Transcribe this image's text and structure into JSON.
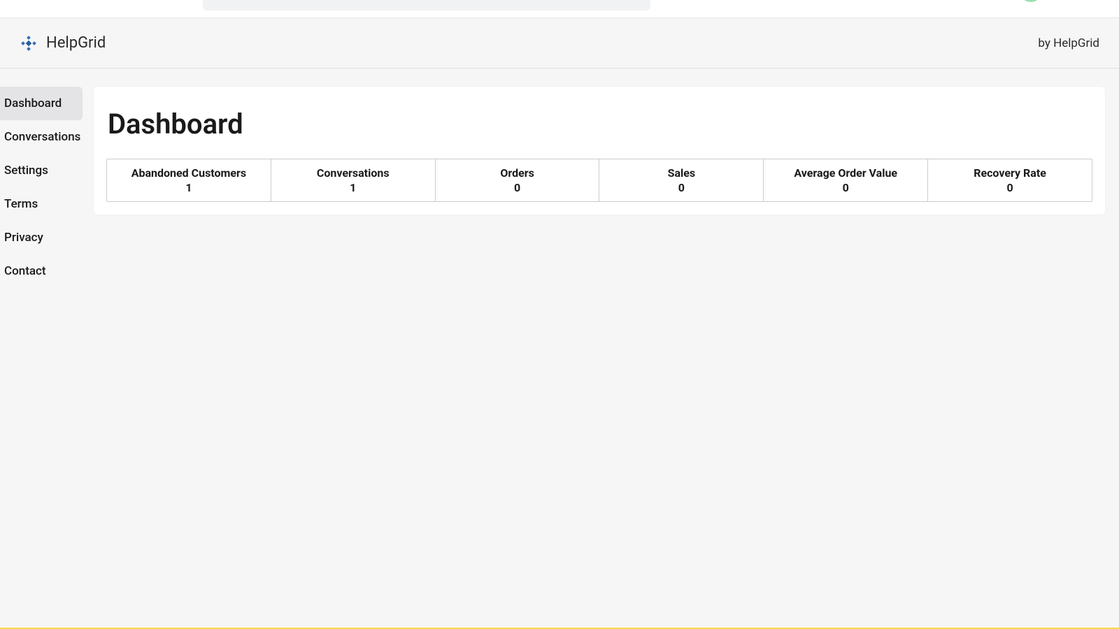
{
  "appbar": {
    "title": "HelpGrid",
    "byline": "by HelpGrid"
  },
  "sidebar": {
    "items": [
      {
        "label": "Dashboard",
        "active": true
      },
      {
        "label": "Conversations",
        "active": false
      },
      {
        "label": "Settings",
        "active": false
      },
      {
        "label": "Terms",
        "active": false
      },
      {
        "label": "Privacy",
        "active": false
      },
      {
        "label": "Contact",
        "active": false
      }
    ]
  },
  "page": {
    "title": "Dashboard"
  },
  "metrics": [
    {
      "label": "Abandoned Customers",
      "value": "1"
    },
    {
      "label": "Conversations",
      "value": "1"
    },
    {
      "label": "Orders",
      "value": "0"
    },
    {
      "label": "Sales",
      "value": "0"
    },
    {
      "label": "Average Order Value",
      "value": "0"
    },
    {
      "label": "Recovery Rate",
      "value": "0"
    }
  ]
}
